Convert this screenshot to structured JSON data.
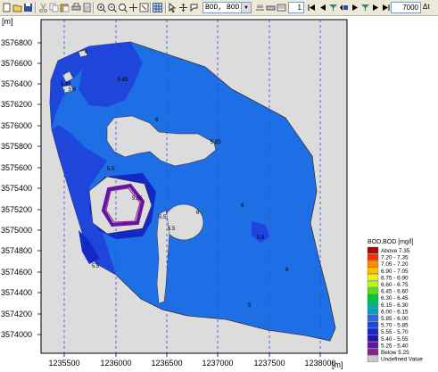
{
  "toolbar": {
    "item_selector_value": "BOD, BOD",
    "timestep_value": "1",
    "zoom_value": "7000",
    "delta_label": "Δt"
  },
  "icons": [
    "new-icon",
    "open-icon",
    "save-icon",
    "cut-icon",
    "copy-icon",
    "paste-icon",
    "print-icon",
    "page-setup-icon",
    "zoom-in-icon",
    "zoom-out-icon",
    "zoom-extent-icon",
    "pan-icon",
    "grid-icon",
    "arrow-icon",
    "move-icon",
    "select-icon",
    "settings-icon",
    "pointer-icon",
    "printer-icon",
    "properties-icon",
    "first-icon",
    "previous-icon",
    "play-icon",
    "stop-icon",
    "next-icon",
    "last-icon",
    "filter-icon",
    "pause-icon"
  ],
  "plot": {
    "y_axis_unit": "[m]",
    "x_axis_unit": "[m]",
    "y_ticks": [
      "3576800",
      "3576600",
      "3576400",
      "3576200",
      "3576000",
      "3575800",
      "3575600",
      "3575400",
      "3575200",
      "3575000",
      "3574800",
      "3574600",
      "3574400",
      "3574200",
      "3574000"
    ],
    "x_ticks": [
      "1235500",
      "1236000",
      "1236500",
      "1237000",
      "1237500",
      "1238000"
    ],
    "contour_labels": [
      "6",
      "5.85",
      "5.85",
      "5.6",
      "6",
      "5.85",
      "5.5",
      "5.85",
      "5.5",
      "5.5",
      "6",
      "6",
      "5.8",
      "6",
      "5.5",
      "5"
    ]
  },
  "legend": {
    "title": "BOD,BOD [mg/l]",
    "entries": [
      {
        "label": "Above 7.35",
        "color": "#b40000"
      },
      {
        "label": "7.20 - 7.35",
        "color": "#ff2b00"
      },
      {
        "label": "7.05 - 7.20",
        "color": "#ff8c00"
      },
      {
        "label": "6.90 - 7.05",
        "color": "#ffbf00"
      },
      {
        "label": "6.75 - 6.90",
        "color": "#f0f000"
      },
      {
        "label": "6.60 - 6.75",
        "color": "#b4ff00"
      },
      {
        "label": "6.45 - 6.60",
        "color": "#50e600"
      },
      {
        "label": "6.30 - 6.45",
        "color": "#00c832"
      },
      {
        "label": "6.15 - 6.30",
        "color": "#00b48c"
      },
      {
        "label": "6.00 - 6.15",
        "color": "#00a0c8"
      },
      {
        "label": "5.85 - 6.00",
        "color": "#1e6ee6"
      },
      {
        "label": "5.70 - 5.85",
        "color": "#1e46dc"
      },
      {
        "label": "5.55 - 5.70",
        "color": "#1428c8"
      },
      {
        "label": "5.40 - 5.55",
        "color": "#2814a0"
      },
      {
        "label": "5.25 - 5.40",
        "color": "#6414a0"
      },
      {
        "label": "Below 5.25",
        "color": "#8c1e8c"
      },
      {
        "label": "Undefined Value",
        "color": "#c8c8c8"
      }
    ]
  },
  "colors": {
    "background": "#dcdcdc",
    "water_main": "#1e6ee6",
    "water_mid": "#1e46dc",
    "water_low": "#1428c8",
    "water_lowest": "#6414a0"
  }
}
